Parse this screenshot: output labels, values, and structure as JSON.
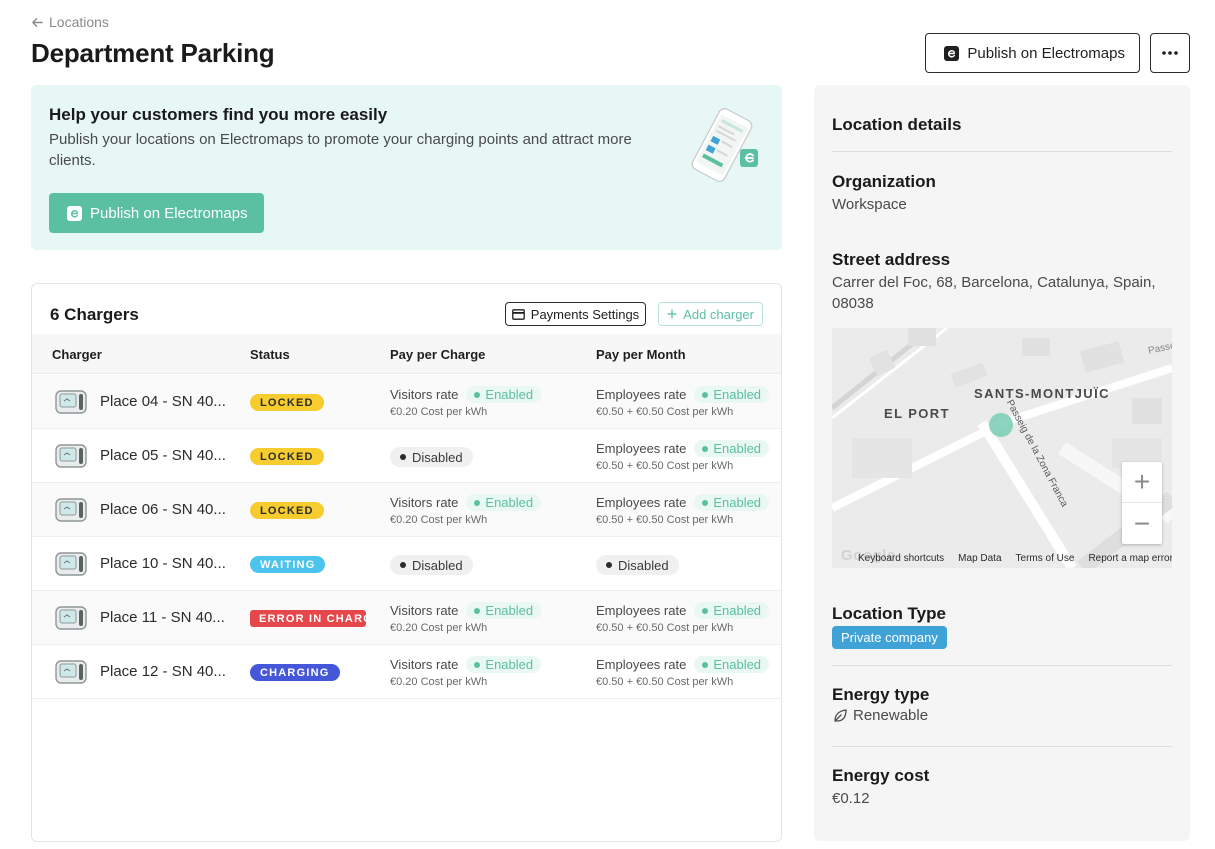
{
  "header": {
    "back_label": "Locations",
    "title": "Department Parking",
    "publish_label": "Publish on Electromaps",
    "more_label": "•••"
  },
  "promo": {
    "title": "Help your customers find you more easily",
    "text": "Publish your locations on Electromaps to promote your charging points and attract more clients.",
    "button_label": "Publish on Electromaps"
  },
  "chargers": {
    "title": "6 Chargers",
    "payments_settings_label": "Payments Settings",
    "add_charger_label": "Add charger",
    "columns": {
      "charger": "Charger",
      "status": "Status",
      "pay_per_charge": "Pay per Charge",
      "pay_per_month": "Pay per Month"
    },
    "rows": [
      {
        "name": "Place 04 - SN 40...",
        "status": "LOCKED",
        "charge_rate": "Visitors rate",
        "charge_state": "Enabled",
        "charge_cost": "€0.20 Cost per kWh",
        "month_rate": "Employees rate",
        "month_state": "Enabled",
        "month_cost": "€0.50 + €0.50 Cost per kWh"
      },
      {
        "name": "Place 05 - SN 40...",
        "status": "LOCKED",
        "charge_state": "Disabled",
        "month_rate": "Employees rate",
        "month_state": "Enabled",
        "month_cost": "€0.50 + €0.50 Cost per kWh"
      },
      {
        "name": "Place 06 - SN 40...",
        "status": "LOCKED",
        "charge_rate": "Visitors rate",
        "charge_state": "Enabled",
        "charge_cost": "€0.20 Cost per kWh",
        "month_rate": "Employees rate",
        "month_state": "Enabled",
        "month_cost": "€0.50 + €0.50 Cost per kWh"
      },
      {
        "name": "Place 10 - SN 40...",
        "status": "WAITING",
        "charge_state": "Disabled",
        "month_state": "Disabled"
      },
      {
        "name": "Place 11 - SN 40...",
        "status": "ERROR IN CHARG",
        "charge_rate": "Visitors rate",
        "charge_state": "Enabled",
        "charge_cost": "€0.20 Cost per kWh",
        "month_rate": "Employees rate",
        "month_state": "Enabled",
        "month_cost": "€0.50 + €0.50 Cost per kWh"
      },
      {
        "name": "Place 12 - SN 40...",
        "status": "CHARGING",
        "charge_rate": "Visitors rate",
        "charge_state": "Enabled",
        "charge_cost": "€0.20 Cost per kWh",
        "month_rate": "Employees rate",
        "month_state": "Enabled",
        "month_cost": "€0.50 + €0.50 Cost per kWh"
      }
    ]
  },
  "details": {
    "title": "Location details",
    "organization_label": "Organization",
    "organization_value": "Workspace",
    "address_label": "Street address",
    "address_value": "Carrer del Foc, 68, Barcelona, Catalunya, Spain, 08038",
    "map": {
      "district_1": "SANTS-MONTJUÏC",
      "district_2": "EL PORT",
      "street": "Passeig de la Zona Franca",
      "street_2": "Passe",
      "google": "Google",
      "zoom_in": "+",
      "zoom_out": "−",
      "footer": [
        "Keyboard shortcuts",
        "Map Data",
        "Terms of Use",
        "Report a map error"
      ]
    },
    "location_type_label": "Location Type",
    "location_type_value": "Private company",
    "energy_type_label": "Energy type",
    "energy_type_value": "Renewable",
    "energy_cost_label": "Energy cost",
    "energy_cost_value": "€0.12"
  },
  "colors": {
    "accent_green": "#5bbfa2",
    "promo_bg": "#e6f7f5",
    "locked": "#f7cc2e",
    "waiting": "#4cc4ee",
    "error": "#e5474b",
    "charging": "#4457d9",
    "location_type_badge": "#3fa3d8"
  },
  "icons": {
    "back": "arrow-left-icon",
    "electromaps": "electromaps-logo-icon",
    "more": "more-dots-icon",
    "card": "credit-card-icon",
    "plus": "plus-icon",
    "charger": "charger-station-icon",
    "leaf": "leaf-icon"
  }
}
